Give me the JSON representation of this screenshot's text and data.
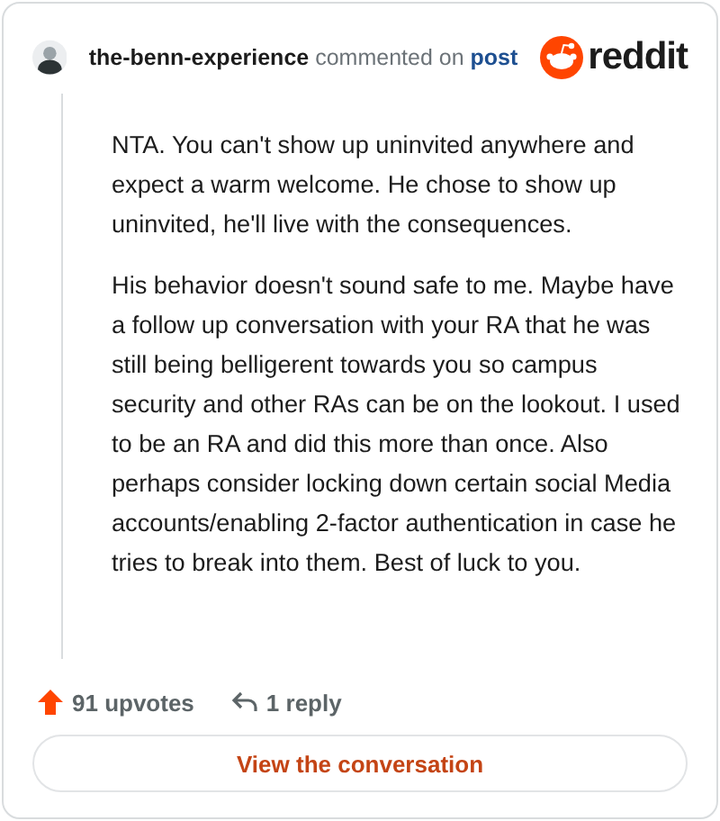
{
  "header": {
    "username": "the-benn-experience",
    "action": "commented on",
    "link": "post",
    "brand": "reddit"
  },
  "comment": {
    "paragraphs": [
      "NTA. You can't show up uninvited anywhere and expect a warm welcome. He chose to show up uninvited, he'll live with the consequences.",
      "His behavior doesn't sound safe to me. Maybe have a follow up conversation with your RA that he was still being belligerent towards you so campus security and other RAs can be on the lookout. I used to be an RA and did this more than once. Also perhaps consider locking down certain social Media accounts/enabling 2-factor authentication in case he tries to break into them. Best of luck to you."
    ]
  },
  "footer": {
    "upvotes": "91 upvotes",
    "replies": "1 reply"
  },
  "button": {
    "label": "View the conversation"
  }
}
